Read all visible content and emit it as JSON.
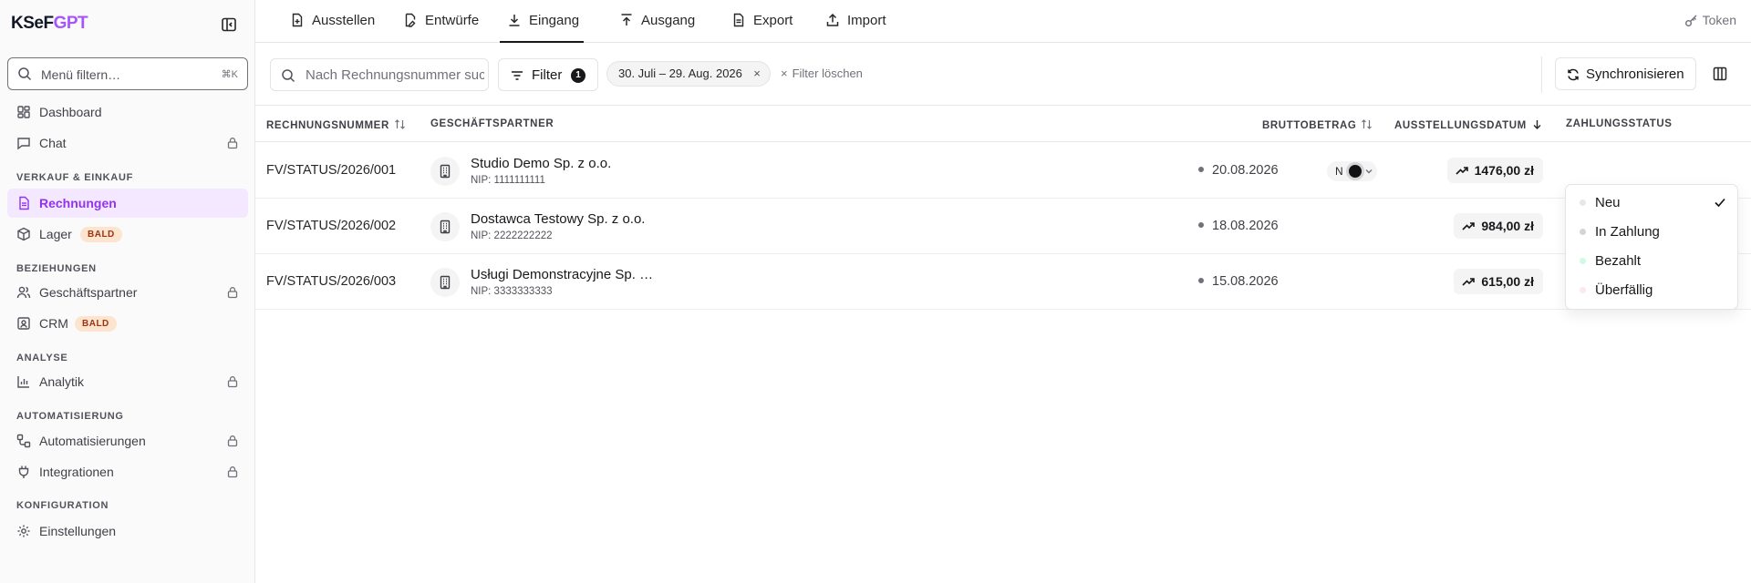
{
  "brand": {
    "part1": "KSeF",
    "part2": "GPT"
  },
  "sidebar": {
    "search_placeholder": "Menü filtern…",
    "search_shortcut": "⌘K",
    "sections": {
      "sales": "VERKAUF & EINKAUF",
      "relations": "BEZIEHUNGEN",
      "analysis": "ANALYSE",
      "automation": "AUTOMATISIERUNG",
      "config": "KONFIGURATION"
    },
    "items": {
      "dashboard": "Dashboard",
      "chat": "Chat",
      "invoices": "Rechnungen",
      "stock": "Lager",
      "partners": "Geschäftspartner",
      "crm": "CRM",
      "analytics": "Analytik",
      "automations": "Automatisierungen",
      "integrations": "Integrationen",
      "settings": "Einstellungen"
    },
    "badge_soon": "BALD"
  },
  "tabs": {
    "issue": "Ausstellen",
    "drafts": "Entwürfe",
    "inbox": "Eingang",
    "outbox": "Ausgang",
    "export": "Export",
    "import": "Import"
  },
  "token_label": "Token",
  "toolbar": {
    "search_placeholder": "Nach Rechnungsnummer suchen",
    "filter_label": "Filter",
    "filter_count": "1",
    "date_chip": "30. Juli – 29. Aug. 2026",
    "chip_remove": "×",
    "clear_label": "Filter löschen",
    "clear_icon": "×",
    "sync_label": "Synchronisieren"
  },
  "table": {
    "headers": {
      "number": "RECHNUNGSNUMMER",
      "partner": "GESCHÄFTSPARTNER",
      "gross": "BRUTTOBETRAG",
      "date": "AUSSTELLUNGSDATUM",
      "status": "ZAHLUNGSSTATUS"
    },
    "rows": [
      {
        "number": "FV/STATUS/2026/001",
        "partner": "Studio Demo Sp. z o.o.",
        "nip": "NIP: 1111111111",
        "amount": "1476,00 zł",
        "date": "20.08.2026",
        "status_short": "N"
      },
      {
        "number": "FV/STATUS/2026/002",
        "partner": "Dostawca Testowy Sp. z o.o.",
        "nip": "NIP: 2222222222",
        "amount": "984,00 zł",
        "date": "18.08.2026"
      },
      {
        "number": "FV/STATUS/2026/003",
        "partner": "Usługi Demonstracyjne Sp. …",
        "nip": "NIP: 3333333333",
        "amount": "615,00 zł",
        "date": "15.08.2026"
      }
    ]
  },
  "status_dropdown": {
    "options": [
      {
        "label": "Neu",
        "color": "#e5e7eb",
        "selected": true
      },
      {
        "label": "In Zahlung",
        "color": "#d4d4d8"
      },
      {
        "label": "Bezahlt",
        "color": "#d1fae5"
      },
      {
        "label": "Überfällig",
        "color": "#fce7f3"
      }
    ]
  },
  "colors": {
    "accent": "#9333ea",
    "accent_bg": "#f3e8ff",
    "badge_bg": "#fde4cf",
    "badge_text": "#9a3412"
  }
}
